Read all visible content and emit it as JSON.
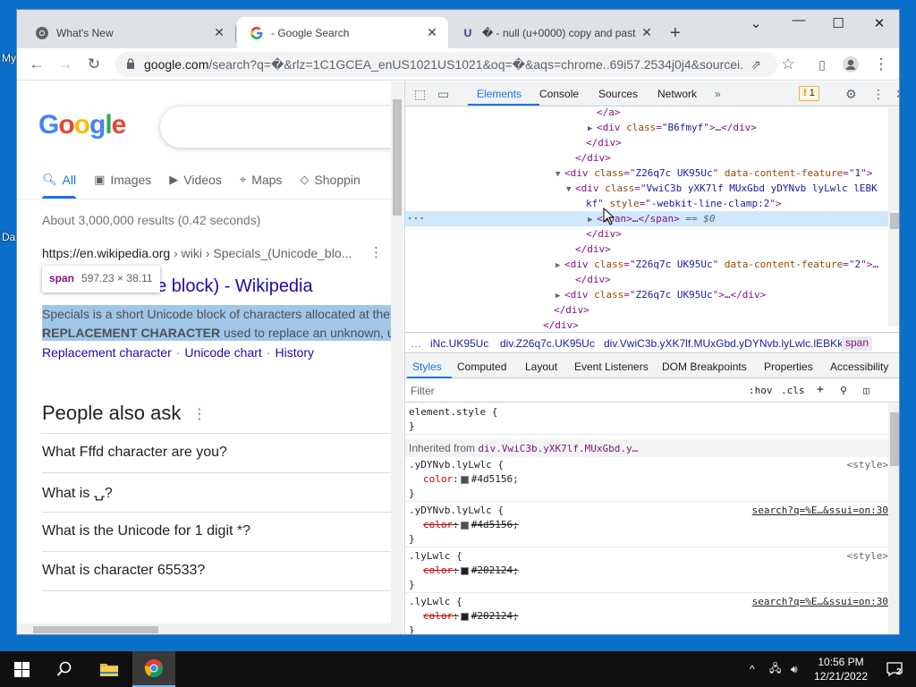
{
  "desktop": {
    "labels": [
      "My",
      "Da"
    ]
  },
  "browser": {
    "tabs": [
      {
        "title": "What's New",
        "icon": "chrome-icon"
      },
      {
        "title": "- Google Search",
        "icon": "google-icon"
      },
      {
        "title": "� - null (u+0000) copy and past",
        "icon": "u-icon"
      }
    ],
    "url_host": "google.com",
    "url_rest": "/search?q=�&rlz=1C1GCEA_enUS1021US1021&oq=�&aqs=chrome..69i57.2534j0j4&sourcei..."
  },
  "google": {
    "logo": "Google",
    "nav": [
      {
        "label": "All",
        "icon": "search-icon"
      },
      {
        "label": "Images",
        "icon": "image-icon"
      },
      {
        "label": "Videos",
        "icon": "video-icon"
      },
      {
        "label": "Maps",
        "icon": "map-pin-icon"
      },
      {
        "label": "Shoppin",
        "icon": "tag-icon"
      }
    ],
    "stats": "About 3,000,000 results (0.42 seconds)",
    "cite_host": "https://en.wikipedia.org",
    "cite_path": " › wiki › Specials_(Unicode_blo...",
    "tooltip_tag": "span",
    "tooltip_dims": "597.23 × 38.11",
    "result_title": "de block) - Wikipedia",
    "snippet_line1": "Specials is a short Unicode block of characters allocated at the",
    "snippet_bold": "REPLACEMENT CHARACTER",
    "snippet_line2": " used to replace an unknown, u",
    "sublinks": [
      "Replacement character",
      "Unicode chart",
      "History"
    ],
    "paa_title": "People also ask",
    "paa": [
      "What Fffd character are you?",
      "What is ⍽?",
      "What is the Unicode for 1 digit *?",
      "What is character 65533?"
    ]
  },
  "devtools": {
    "tabs": [
      "Elements",
      "Console",
      "Sources",
      "Network",
      "»"
    ],
    "issues_count": "1",
    "elements": [
      {
        "indent": 17,
        "parts": [
          [
            "tag",
            "</a>"
          ]
        ]
      },
      {
        "indent": 17,
        "tri": "▶",
        "parts": [
          [
            "tag",
            "<div "
          ],
          [
            "an",
            "class"
          ],
          [
            "tag",
            "=\""
          ],
          [
            "av",
            "B6fmyf"
          ],
          [
            "tag",
            "\">"
          ],
          [
            "tx",
            "…"
          ],
          [
            "tag",
            "</div>"
          ]
        ]
      },
      {
        "indent": 16,
        "parts": [
          [
            "tag",
            "</div>"
          ]
        ]
      },
      {
        "indent": 15,
        "parts": [
          [
            "tag",
            "</div>"
          ]
        ]
      },
      {
        "indent": 14,
        "tri": "▼",
        "parts": [
          [
            "tag",
            "<div "
          ],
          [
            "an",
            "class"
          ],
          [
            "tag",
            "=\""
          ],
          [
            "av",
            "Z26q7c UK95Uc"
          ],
          [
            "tag",
            "\" "
          ],
          [
            "an",
            "data-content-feature"
          ],
          [
            "tag",
            "=\""
          ],
          [
            "av",
            "1"
          ],
          [
            "tag",
            "\">"
          ]
        ]
      },
      {
        "indent": 15,
        "tri": "▼",
        "parts": [
          [
            "tag",
            "<div "
          ],
          [
            "an",
            "class"
          ],
          [
            "tag",
            "=\""
          ],
          [
            "av",
            "VwiC3b yXK7lf MUxGbd yDYNvb lyLwlc lEBK"
          ]
        ]
      },
      {
        "indent": 16,
        "parts": [
          [
            "av",
            "kf"
          ],
          [
            "tag",
            "\" "
          ],
          [
            "an",
            "style"
          ],
          [
            "tag",
            "=\""
          ],
          [
            "av",
            "-webkit-line-clamp:2"
          ],
          [
            "tag",
            "\">"
          ]
        ]
      },
      {
        "indent": 17,
        "tri": "▶",
        "sel": true,
        "parts": [
          [
            "tag",
            "<span>"
          ],
          [
            "tx",
            "…"
          ],
          [
            "tag",
            "</span>"
          ],
          [
            "dl",
            " == $0"
          ]
        ]
      },
      {
        "indent": 16,
        "parts": [
          [
            "tag",
            "</div>"
          ]
        ]
      },
      {
        "indent": 15,
        "parts": [
          [
            "tag",
            "</div>"
          ]
        ]
      },
      {
        "indent": 14,
        "tri": "▶",
        "parts": [
          [
            "tag",
            "<div "
          ],
          [
            "an",
            "class"
          ],
          [
            "tag",
            "=\""
          ],
          [
            "av",
            "Z26q7c UK95Uc"
          ],
          [
            "tag",
            "\" "
          ],
          [
            "an",
            "data-content-feature"
          ],
          [
            "tag",
            "=\""
          ],
          [
            "av",
            "2"
          ],
          [
            "tag",
            "\">"
          ],
          [
            "tx",
            "…"
          ]
        ]
      },
      {
        "indent": 15,
        "parts": [
          [
            "tag",
            "</div>"
          ]
        ]
      },
      {
        "indent": 14,
        "tri": "▶",
        "parts": [
          [
            "tag",
            "<div "
          ],
          [
            "an",
            "class"
          ],
          [
            "tag",
            "=\""
          ],
          [
            "av",
            "Z26q7c UK95Uc"
          ],
          [
            "tag",
            "\">"
          ],
          [
            "tx",
            "…"
          ],
          [
            "tag",
            "</div>"
          ]
        ]
      },
      {
        "indent": 13,
        "parts": [
          [
            "tag",
            "</div>"
          ]
        ]
      },
      {
        "indent": 12,
        "parts": [
          [
            "tag",
            "</div>"
          ]
        ]
      }
    ],
    "crumbs": [
      "…",
      "iNc.UK95Uc",
      "div.Z26q7c.UK95Uc",
      "div.VwiC3b.yXK7lf.MUxGbd.yDYNvb.lyLwlc.lEBKkf",
      "span"
    ],
    "style_tabs": [
      "Styles",
      "Computed",
      "Layout",
      "Event Listeners",
      "DOM Breakpoints",
      "Properties",
      "Accessibility"
    ],
    "filter_placeholder": "Filter",
    "filter_hov": ":hov",
    "filter_cls": ".cls",
    "element_style": [
      "element.style {",
      "}"
    ],
    "inherited_label": "Inherited from ",
    "inherited_selector": "div.VwiC3b.yXK7lf.MUxGbd.y…",
    "rules": [
      {
        "selector": ".yDYNvb.lyLwlc {",
        "source": "<style>",
        "source_link": false,
        "prop": "color",
        "value": "#4d5156",
        "struck": false,
        "swatch": "#4d5156"
      },
      {
        "selector": ".yDYNvb.lyLwlc {",
        "source": "search?q=%E…&ssui=on:30",
        "source_link": true,
        "prop": "color",
        "value": "#4d5156",
        "struck": true,
        "swatch": "#4d5156"
      },
      {
        "selector": ".lyLwlc {",
        "source": "<style>",
        "source_link": false,
        "prop": "color",
        "value": "#202124",
        "struck": true,
        "swatch": "#202124"
      },
      {
        "selector": ".lyLwlc {",
        "source": "search?q=%E…&ssui=on:30",
        "source_link": true,
        "prop": "color",
        "value": "#202124",
        "struck": true,
        "swatch": "#202124"
      }
    ]
  },
  "taskbar": {
    "time": "10:56 PM",
    "date": "12/21/2022",
    "notifications": "2"
  }
}
